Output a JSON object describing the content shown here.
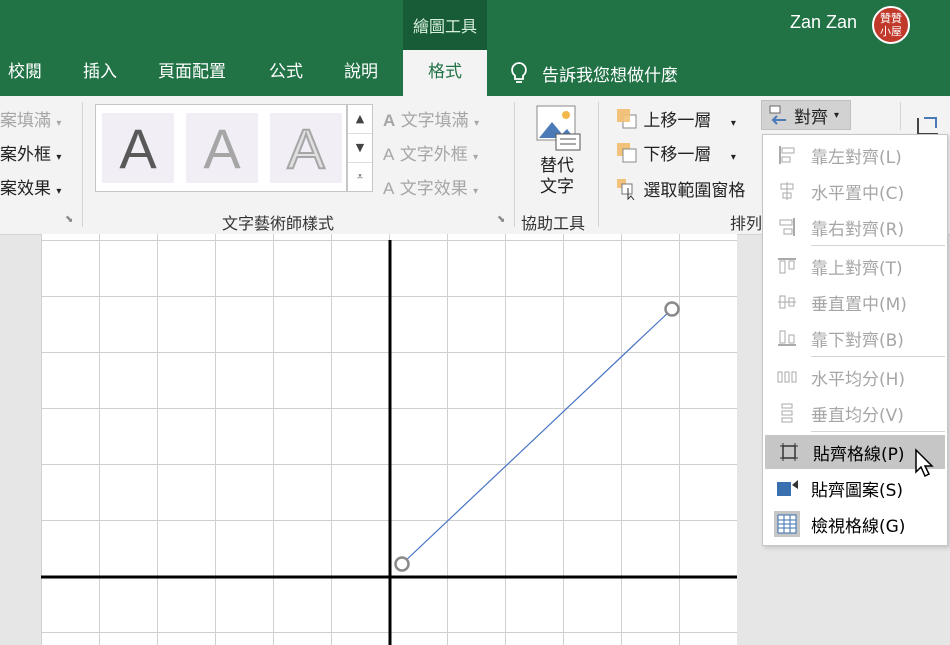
{
  "titlebar": {
    "tools_tab": "繪圖工具",
    "user_name": "Zan Zan",
    "avatar_text": "贊贊小屋"
  },
  "tabs": [
    {
      "label": "校閱"
    },
    {
      "label": "插入"
    },
    {
      "label": "頁面配置"
    },
    {
      "label": "公式"
    },
    {
      "label": "說明"
    },
    {
      "label": "格式"
    }
  ],
  "tell_me": "告訴我您想做什麼",
  "ribbon": {
    "shape_fill_partial": "案填滿",
    "shape_outline_partial": "案外框",
    "shape_effects_partial": "案效果",
    "wordart_letter": "A",
    "text_fill": "文字填滿",
    "text_outline": "文字外框",
    "text_effects": "文字效果",
    "wordart_group": "文字藝術師樣式",
    "alt_text_line1": "替代",
    "alt_text_line2": "文字",
    "accessibility_group": "協助工具",
    "bring_forward": "上移一層",
    "send_backward": "下移一層",
    "selection_pane": "選取範圍窗格",
    "arrange_group_partial": "排列",
    "align_button": "對齊"
  },
  "align_menu": [
    {
      "label": "靠左對齊(L)",
      "icon": "align-left-icon",
      "enabled": false
    },
    {
      "label": "水平置中(C)",
      "icon": "align-center-icon",
      "enabled": false
    },
    {
      "label": "靠右對齊(R)",
      "icon": "align-right-icon",
      "enabled": false
    },
    {
      "label": "靠上對齊(T)",
      "icon": "align-top-icon",
      "enabled": false
    },
    {
      "label": "垂直置中(M)",
      "icon": "align-middle-icon",
      "enabled": false
    },
    {
      "label": "靠下對齊(B)",
      "icon": "align-bottom-icon",
      "enabled": false
    },
    {
      "label": "水平均分(H)",
      "icon": "distribute-horizontal-icon",
      "enabled": false
    },
    {
      "label": "垂直均分(V)",
      "icon": "distribute-vertical-icon",
      "enabled": false
    },
    {
      "label": "貼齊格線(P)",
      "icon": "snap-to-grid-icon",
      "enabled": true,
      "highlighted": true
    },
    {
      "label": "貼齊圖案(S)",
      "icon": "snap-to-shape-icon",
      "enabled": true
    },
    {
      "label": "檢視格線(G)",
      "icon": "view-gridlines-icon",
      "enabled": true
    }
  ],
  "colors": {
    "excel_green": "#217346",
    "dark_green": "#185c37",
    "line_blue": "#4472c4"
  }
}
